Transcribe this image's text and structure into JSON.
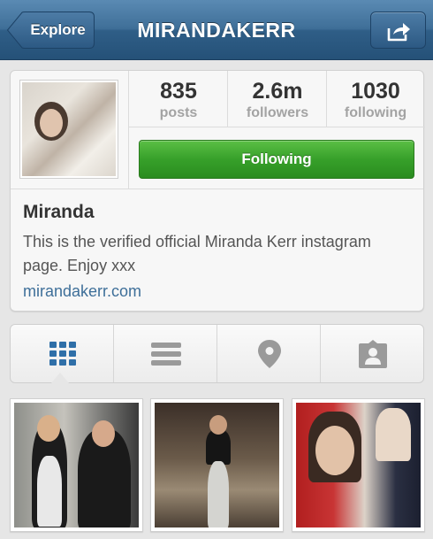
{
  "nav": {
    "back_label": "Explore",
    "title": "MIRANDAKERR",
    "share_icon": "share-icon"
  },
  "profile": {
    "stats": [
      {
        "value": "835",
        "label": "posts"
      },
      {
        "value": "2.6m",
        "label": "followers"
      },
      {
        "value": "1030",
        "label": "following"
      }
    ],
    "follow_button": "Following",
    "name": "Miranda",
    "bio": "This is the verified official Miranda Kerr instagram page. Enjoy xxx",
    "website": "mirandakerr.com"
  },
  "tabs": [
    {
      "icon": "grid-icon",
      "active": true
    },
    {
      "icon": "list-icon",
      "active": false
    },
    {
      "icon": "map-pin-icon",
      "active": false
    },
    {
      "icon": "tagged-user-icon",
      "active": false
    }
  ],
  "colors": {
    "nav_blue": "#3f6f98",
    "follow_green": "#37a02a",
    "link_blue": "#3e6f99",
    "active_tab": "#2f6fa8"
  }
}
